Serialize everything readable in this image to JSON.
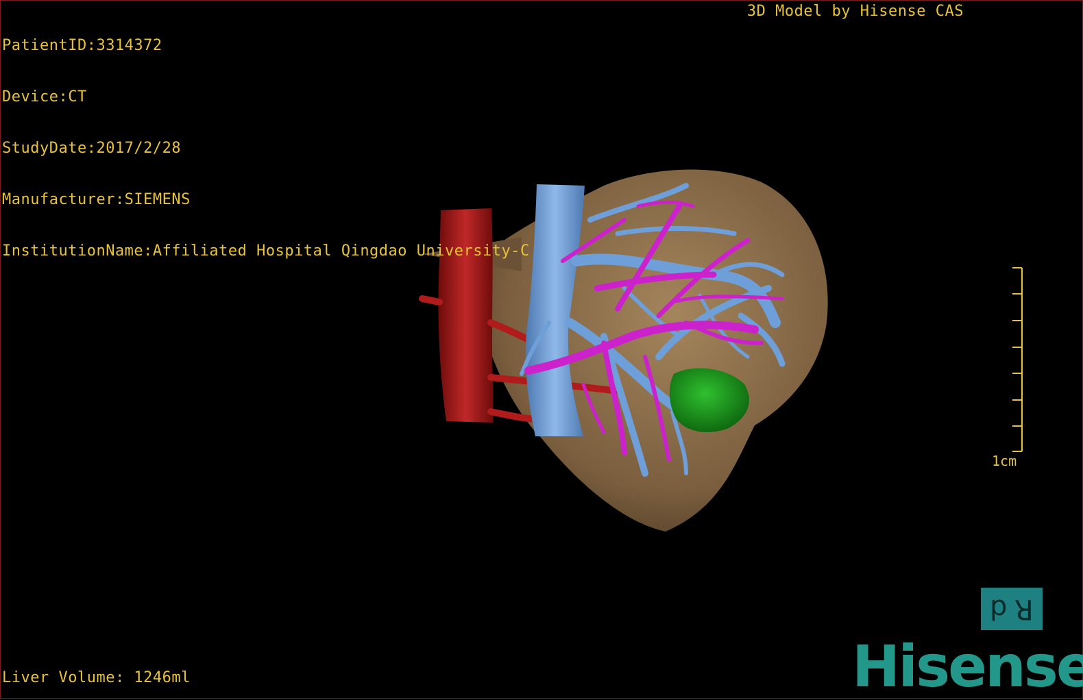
{
  "meta": {
    "patient_id": "PatientID:3314372",
    "device": "Device:CT",
    "study_date": "StudyDate:2017/2/28",
    "manufacturer": "Manufacturer:SIEMENS",
    "institution": "InstitutionName:Affiliated Hospital Qingdao University-C"
  },
  "brand_top": "3D Model by Hisense CAS",
  "volume": "Liver Volume: 1246ml",
  "scale": {
    "label": "1cm"
  },
  "orientation": {
    "left_glyph": "d",
    "right_glyph": "R"
  },
  "logo_text": "Hisense",
  "colors": {
    "overlay_text": "#e8c23a",
    "liver": "#8a6d4a",
    "aorta": "#a01818",
    "vena_cava": "#6f9fd8",
    "portal_branches": "#cc22cc",
    "tumor": "#1f9a1f",
    "logo": "#23988a"
  }
}
